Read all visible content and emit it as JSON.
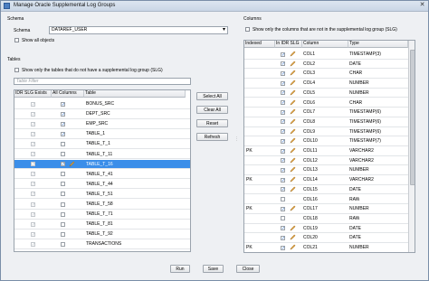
{
  "window": {
    "title": "Manage Oracle Supplemental Log Groups",
    "close_glyph": "✕"
  },
  "schema": {
    "section": "Schema",
    "label": "Schema",
    "value": "DATAREF_USER",
    "show_all": "Show all objects"
  },
  "tables": {
    "section": "Tables",
    "show_only": "Show only the tables that do not have a supplemental log group (SLG)",
    "filter_placeholder": "Table Filter",
    "columns": [
      "IDR SLG Exists",
      "All Columns",
      "Table"
    ],
    "rows": [
      {
        "slg": true,
        "all": true,
        "name": "BONUS_SRC",
        "selected": false
      },
      {
        "slg": true,
        "all": true,
        "name": "DEPT_SRC",
        "selected": false
      },
      {
        "slg": true,
        "all": true,
        "name": "EMP_SRC",
        "selected": false
      },
      {
        "slg": true,
        "all": true,
        "name": "TABLE_1",
        "selected": false
      },
      {
        "slg": true,
        "all": false,
        "name": "TABLE_T_1",
        "selected": false
      },
      {
        "slg": true,
        "all": false,
        "name": "TABLE_T_11",
        "selected": false
      },
      {
        "slg": true,
        "all": true,
        "name": "TABLE_T_16",
        "selected": true
      },
      {
        "slg": true,
        "all": false,
        "name": "TABLE_T_41",
        "selected": false
      },
      {
        "slg": true,
        "all": false,
        "name": "TABLE_T_44",
        "selected": false
      },
      {
        "slg": true,
        "all": false,
        "name": "TABLE_T_51",
        "selected": false
      },
      {
        "slg": true,
        "all": false,
        "name": "TABLE_T_58",
        "selected": false
      },
      {
        "slg": true,
        "all": false,
        "name": "TABLE_T_71",
        "selected": false
      },
      {
        "slg": true,
        "all": false,
        "name": "TABLE_T_81",
        "selected": false
      },
      {
        "slg": true,
        "all": false,
        "name": "TABLE_T_92",
        "selected": false
      },
      {
        "slg": true,
        "all": false,
        "name": "TRANSACTIONS",
        "selected": false
      }
    ],
    "buttons": {
      "select_all": "Select All",
      "clear_all": "Clear All",
      "reset": "Reset",
      "refresh": "Refresh"
    }
  },
  "columns": {
    "section": "Columns",
    "show_only": "Show only the columns that are not in the supplemental log group (SLG)",
    "headers": [
      "Indexed",
      "In IDR SLG",
      "Column",
      "Type"
    ],
    "rows": [
      {
        "indexed": "",
        "in_slg": true,
        "edit": true,
        "col": "COL1",
        "type": "TIMESTAMP(3)"
      },
      {
        "indexed": "",
        "in_slg": true,
        "edit": true,
        "col": "COL2",
        "type": "DATE"
      },
      {
        "indexed": "",
        "in_slg": true,
        "edit": true,
        "col": "COL3",
        "type": "CHAR"
      },
      {
        "indexed": "",
        "in_slg": true,
        "edit": true,
        "col": "COL4",
        "type": "NUMBER"
      },
      {
        "indexed": "",
        "in_slg": true,
        "edit": true,
        "col": "COL5",
        "type": "NUMBER"
      },
      {
        "indexed": "",
        "in_slg": true,
        "edit": true,
        "col": "COL6",
        "type": "CHAR"
      },
      {
        "indexed": "",
        "in_slg": true,
        "edit": true,
        "col": "COL7",
        "type": "TIMESTAMP(6)"
      },
      {
        "indexed": "",
        "in_slg": true,
        "edit": true,
        "col": "COL8",
        "type": "TIMESTAMP(6)"
      },
      {
        "indexed": "",
        "in_slg": true,
        "edit": true,
        "col": "COL9",
        "type": "TIMESTAMP(6)"
      },
      {
        "indexed": "",
        "in_slg": true,
        "edit": true,
        "col": "COL10",
        "type": "TIMESTAMP(7)"
      },
      {
        "indexed": "PK",
        "in_slg": true,
        "edit": true,
        "col": "COL11",
        "type": "VARCHAR2"
      },
      {
        "indexed": "",
        "in_slg": true,
        "edit": true,
        "col": "COL12",
        "type": "VARCHAR2"
      },
      {
        "indexed": "",
        "in_slg": true,
        "edit": true,
        "col": "COL13",
        "type": "NUMBER"
      },
      {
        "indexed": "PK",
        "in_slg": true,
        "edit": true,
        "col": "COL14",
        "type": "VARCHAR2"
      },
      {
        "indexed": "",
        "in_slg": true,
        "edit": true,
        "col": "COL15",
        "type": "DATE"
      },
      {
        "indexed": "",
        "in_slg": false,
        "edit": false,
        "col": "COL16",
        "type": "RAW"
      },
      {
        "indexed": "PK",
        "in_slg": true,
        "edit": true,
        "col": "COL17",
        "type": "NUMBER"
      },
      {
        "indexed": "",
        "in_slg": false,
        "edit": false,
        "col": "COL18",
        "type": "RAW"
      },
      {
        "indexed": "",
        "in_slg": true,
        "edit": true,
        "col": "COL19",
        "type": "DATE"
      },
      {
        "indexed": "",
        "in_slg": true,
        "edit": true,
        "col": "COL20",
        "type": "DATE"
      },
      {
        "indexed": "PK",
        "in_slg": true,
        "edit": true,
        "col": "COL21",
        "type": "NUMBER"
      }
    ]
  },
  "footer": {
    "run": "Run",
    "save": "Save",
    "close": "Close"
  },
  "colors": {
    "selection": "#3b8ee9",
    "check": "#2c6cc8",
    "window_bg": "#eef0f3"
  },
  "icons": {
    "edit": "pencil-icon",
    "checkmark": "✓",
    "dropdown": "▾"
  }
}
